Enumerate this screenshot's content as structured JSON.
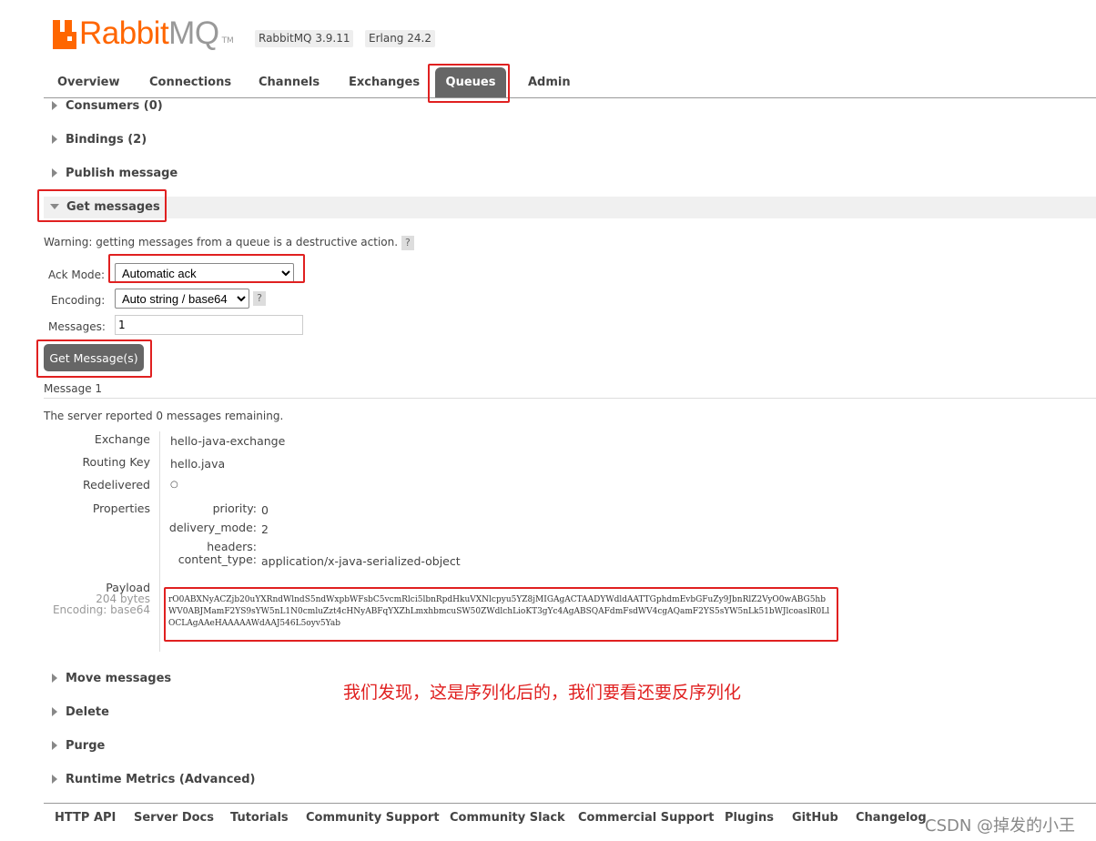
{
  "header": {
    "logo_rabbit": "Rabbit",
    "logo_mq": "MQ",
    "logo_tm": "TM",
    "version": "RabbitMQ 3.9.11",
    "erlang": "Erlang 24.2"
  },
  "tabs": [
    {
      "label": "Overview"
    },
    {
      "label": "Connections"
    },
    {
      "label": "Channels"
    },
    {
      "label": "Exchanges"
    },
    {
      "label": "Queues"
    },
    {
      "label": "Admin"
    }
  ],
  "sections": {
    "consumers": "Consumers (0)",
    "bindings": "Bindings (2)",
    "publish": "Publish message",
    "get": "Get messages",
    "move": "Move messages",
    "delete": "Delete",
    "purge": "Purge",
    "runtime": "Runtime Metrics (Advanced)"
  },
  "get_messages": {
    "warning": "Warning: getting messages from a queue is a destructive action.",
    "help": "?",
    "ack_mode_label": "Ack Mode:",
    "ack_mode_value": "Automatic ack",
    "encoding_label": "Encoding:",
    "encoding_value": "Auto string / base64",
    "messages_label": "Messages:",
    "messages_value": "1",
    "button": "Get Message(s)"
  },
  "result": {
    "message_title": "Message 1",
    "server_reported_prefix": "The server reported ",
    "remaining_count": "0",
    "server_reported_suffix": " messages remaining.",
    "exchange_label": "Exchange",
    "exchange_value": "hello-java-exchange",
    "routing_key_label": "Routing Key",
    "routing_key_value": "hello.java",
    "redelivered_label": "Redelivered",
    "redelivered_value": "○",
    "properties_label": "Properties",
    "props": {
      "priority_label": "priority:",
      "priority_value": "0",
      "delivery_mode_label": "delivery_mode:",
      "delivery_mode_value": "2",
      "headers_label": "headers:",
      "content_type_label": "content_type:",
      "content_type_value": "application/x-java-serialized-object"
    },
    "payload_label": "Payload",
    "payload_bytes": "204 bytes",
    "payload_encoding": "Encoding: base64",
    "payload_text": "rO0ABXNyACZjb20uYXRndWlndS5ndWxpbWFsbC5vcmRlci5lbnRpdHkuVXNlcpyu5YZ8jMIGAgACTAADYWdldAATTGphdmEvbGFuZy9JbnRlZ2VyO0wABG5hbWV0ABJMamF2YS9sYW5nL1N0cmluZzt4cHNyABFqYXZhLmxhbmcuSW50ZWdlchLioKT3gYc4AgABSQAFdmFsdWV4cgAQamF2YS5sYW5nLk51bWJlcoaslR0LlOCLAgAAeHAAAAAWdAAJ546L5oyv5Yab"
  },
  "annotation": "我们发现，这是序列化后的，我们要看还要反序列化",
  "footer": [
    {
      "label": "HTTP API"
    },
    {
      "label": "Server Docs"
    },
    {
      "label": "Tutorials"
    },
    {
      "label": "Community Support"
    },
    {
      "label": "Community Slack"
    },
    {
      "label": "Commercial Support"
    },
    {
      "label": "Plugins"
    },
    {
      "label": "GitHub"
    },
    {
      "label": "Changelog"
    }
  ],
  "watermark": "CSDN @掉发的小王",
  "colors": {
    "brand_orange": "#ff6600",
    "tab_active": "#666666",
    "highlight_red": "#e02020"
  }
}
